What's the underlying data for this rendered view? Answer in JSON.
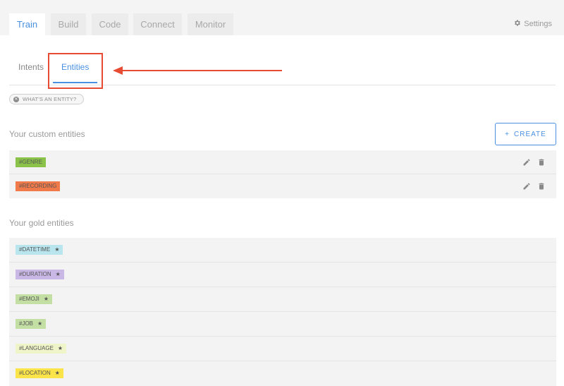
{
  "top_tabs": [
    {
      "label": "Train",
      "active": true
    },
    {
      "label": "Build",
      "active": false
    },
    {
      "label": "Code",
      "active": false
    },
    {
      "label": "Connect",
      "active": false
    },
    {
      "label": "Monitor",
      "active": false
    }
  ],
  "settings": {
    "label": "Settings",
    "icon": "gear-icon"
  },
  "sub_tabs": [
    {
      "label": "Intents",
      "active": false
    },
    {
      "label": "Entities",
      "active": true
    }
  ],
  "help_chip": {
    "label": "WHAT'S AN ENTITY?",
    "icon": "close-circle-icon"
  },
  "custom_section": {
    "title": "Your custom entities",
    "create_label": "CREATE",
    "create_icon": "+",
    "items": [
      {
        "name": "#GENRE",
        "color": "#8bc34a"
      },
      {
        "name": "#RECORDING",
        "color": "#f07a4a"
      }
    ]
  },
  "gold_section": {
    "title": "Your gold entities",
    "star_icon": "★",
    "items": [
      {
        "name": "#DATETIME",
        "color": "#b9e6ee"
      },
      {
        "name": "#DURATION",
        "color": "#c9b8e6"
      },
      {
        "name": "#EMOJI",
        "color": "#c3dfa4"
      },
      {
        "name": "#JOB",
        "color": "#c3dfa4"
      },
      {
        "name": "#LANGUAGE",
        "color": "#eff5c8"
      },
      {
        "name": "#LOCATION",
        "color": "#fbe44a"
      }
    ]
  },
  "colors": {
    "accent": "#4a90e2",
    "annotation": "#e84b33"
  }
}
